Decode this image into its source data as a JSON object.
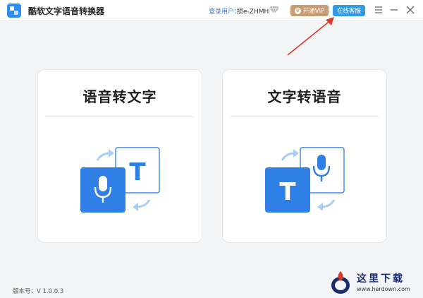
{
  "titlebar": {
    "app_title": "酷软文字语音转换器",
    "user_label": "登录用户：",
    "username": "损e-ZHMH",
    "vip_label": "开通VIP",
    "service_label": "在线客服",
    "icons": [
      "menu-icon",
      "minimize-icon",
      "close-icon",
      "diamond-icon"
    ]
  },
  "cards": [
    {
      "title": "语音转文字",
      "illustration": "mic-to-text"
    },
    {
      "title": "文字转语音",
      "illustration": "text-to-mic"
    }
  ],
  "footer": {
    "version": "版本号：V 1.0.0.3"
  },
  "watermark": {
    "name": "这里下载",
    "url": "www.herdown.com"
  },
  "colors": {
    "accent": "#2f8af4",
    "vip": "#c99c72",
    "service": "#2f9be9",
    "annotation": "#d83a2e"
  }
}
